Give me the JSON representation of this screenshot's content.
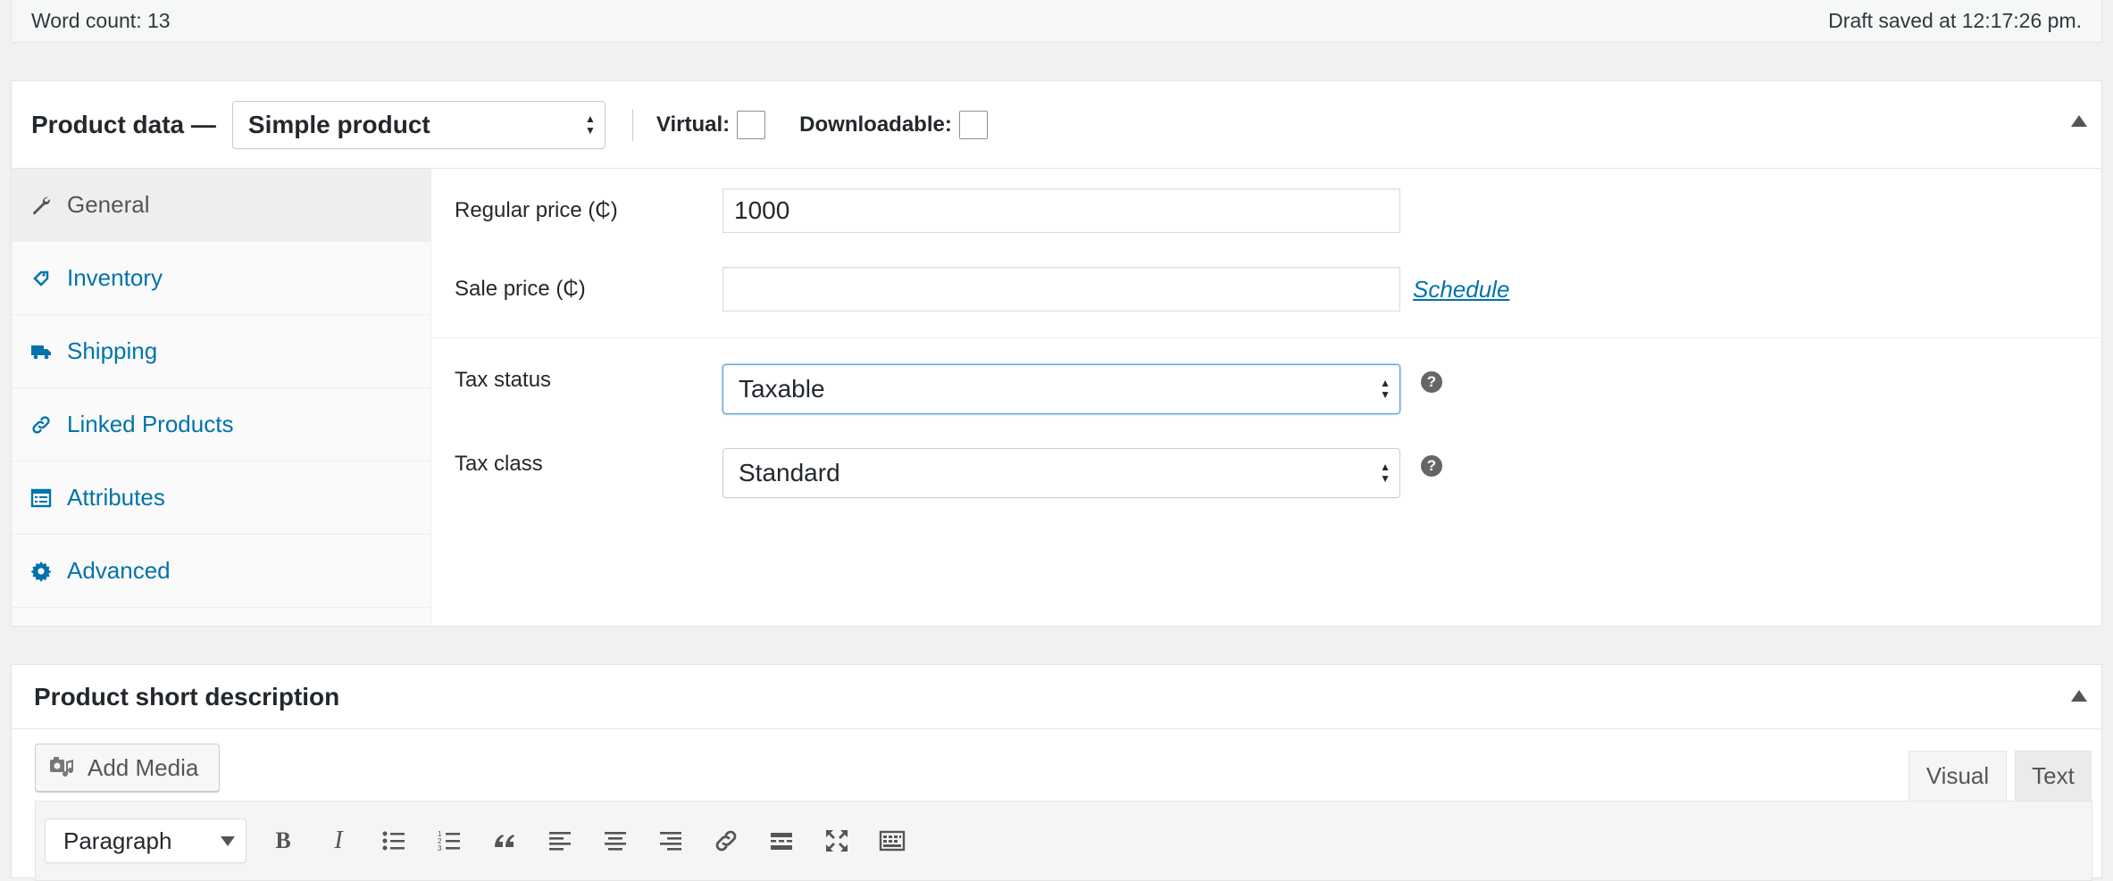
{
  "status_bar": {
    "word_count": "Word count: 13",
    "draft_saved": "Draft saved at 12:17:26 pm."
  },
  "product_data": {
    "title": "Product data —",
    "product_type": "Simple product",
    "virtual_label": "Virtual:",
    "downloadable_label": "Downloadable:",
    "virtual_checked": false,
    "downloadable_checked": false
  },
  "tabs": [
    {
      "label": "General",
      "icon": "wrench-icon",
      "active": true
    },
    {
      "label": "Inventory",
      "icon": "tag-icon",
      "active": false
    },
    {
      "label": "Shipping",
      "icon": "truck-icon",
      "active": false
    },
    {
      "label": "Linked Products",
      "icon": "link-icon",
      "active": false
    },
    {
      "label": "Attributes",
      "icon": "list-icon",
      "active": false
    },
    {
      "label": "Advanced",
      "icon": "gear-icon",
      "active": false
    }
  ],
  "general": {
    "regular_price_label": "Regular price (₵)",
    "regular_price_value": "1000",
    "sale_price_label": "Sale price (₵)",
    "sale_price_value": "",
    "schedule_link": "Schedule",
    "tax_status_label": "Tax status",
    "tax_status_value": "Taxable",
    "tax_class_label": "Tax class",
    "tax_class_value": "Standard",
    "help_glyph": "?"
  },
  "short_description": {
    "title": "Product short description",
    "add_media": "Add Media",
    "visual_tab": "Visual",
    "text_tab": "Text",
    "format_select": "Paragraph",
    "toolbar_icons": [
      "bold-icon",
      "italic-icon",
      "bullet-list-icon",
      "numbered-list-icon",
      "blockquote-icon",
      "align-left-icon",
      "align-center-icon",
      "align-right-icon",
      "link-icon",
      "read-more-icon",
      "fullscreen-icon",
      "toolbar-toggle-icon"
    ]
  },
  "colors": {
    "link_blue": "#0073aa",
    "focus_blue": "#5b9dd9"
  }
}
